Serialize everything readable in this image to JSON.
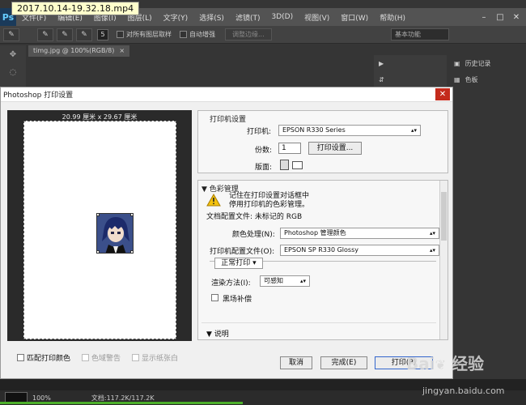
{
  "video_label": "2017.10.14-19.32.18.mp4",
  "menubar": {
    "logo": "Ps",
    "items": [
      "文件(F)",
      "编辑(E)",
      "图像(I)",
      "图层(L)",
      "文字(Y)",
      "选择(S)",
      "滤镜(T)",
      "3D(D)",
      "视图(V)",
      "窗口(W)",
      "帮助(H)"
    ]
  },
  "optionsbar": {
    "brush_size": "5",
    "sample_all_layers": "对所有图层取样",
    "auto_enhance": "自动增强",
    "refine_edge": "调整边缘...",
    "workspace": "基本功能"
  },
  "document_tab": {
    "name": "timg.jpg @ 100%(RGB/8)",
    "close": "×"
  },
  "panels": {
    "history": "历史记录",
    "color": "色板"
  },
  "statusbar": {
    "zoom": "100%",
    "doc": "文档:117.2K/117.2K"
  },
  "dialog": {
    "title": "Photoshop 打印设置",
    "close": "✕",
    "paper_size": "20.99 厘米 x 29.67 厘米",
    "match_colors": "匹配打印颜色",
    "gamut_warning": "色域警告",
    "show_paper_white": "显示纸张白",
    "printer_setup": {
      "heading": "打印机设置",
      "printer_label": "打印机:",
      "printer_value": "EPSON R330 Series",
      "copies_label": "份数:",
      "copies_value": "1",
      "print_settings_btn": "打印设置...",
      "layout_label": "版面:"
    },
    "color_mgmt": {
      "heading": "色彩管理",
      "notice_line1": "记住在打印设置对话框中",
      "notice_line2": "停用打印机的色彩管理。",
      "doc_profile": "文档配置文件: 未标记的 RGB",
      "color_handling_label": "颜色处理(N):",
      "color_handling_value": "Photoshop 管理颜色",
      "printer_profile_label": "打印机配置文件(O):",
      "printer_profile_value": "EPSON SP R330 Glossy",
      "normal_print": "正常打印",
      "rendering_label": "渲染方法(I):",
      "rendering_value": "可感知",
      "black_point": "黑场补偿"
    },
    "description_heading": "说明",
    "buttons": {
      "cancel": "取消",
      "done": "完成(E)",
      "print": "打印(P)"
    }
  },
  "watermark": {
    "site": "经验",
    "url": "jingyan.baidu.com"
  }
}
